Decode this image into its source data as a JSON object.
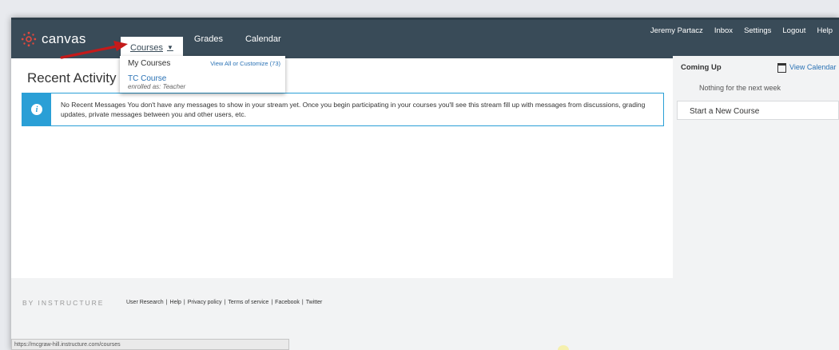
{
  "header": {
    "logo_text": "canvas",
    "nav": [
      {
        "label": "Courses",
        "caret": "▼"
      },
      {
        "label": "Grades"
      },
      {
        "label": "Calendar"
      }
    ],
    "user_menu": [
      "Jeremy Partacz",
      "Inbox",
      "Settings",
      "Logout",
      "Help"
    ]
  },
  "dropdown": {
    "my_courses": "My Courses",
    "view_all": "View All or Customize (73)",
    "course_name": "TC Course",
    "course_role": "enrolled as: Teacher"
  },
  "main": {
    "title": "Recent Activity",
    "alert_icon": "i",
    "alert_text": "No Recent Messages  You don't have any messages to show in your stream yet. Once you begin participating in your courses you'll see this stream fill up with messages from discussions, grading updates, private messages between you and other users, etc."
  },
  "sidebar": {
    "coming_up": "Coming Up",
    "view_calendar": "View Calendar",
    "nothing": "Nothing for the next week",
    "new_course": "Start a New Course"
  },
  "footer": {
    "brand": "BY INSTRUCTURE",
    "links": [
      "User Research",
      "Help",
      "Privacy policy",
      "Terms of service",
      "Facebook",
      "Twitter"
    ]
  },
  "statusbar": "https://mcgraw-hill.instructure.com/courses",
  "colors": {
    "header_bg": "#394b58",
    "link": "#2a72b5",
    "alert": "#2a9fd6",
    "logo": "#e2483d",
    "arrow": "#c41a1a"
  },
  "icons": [
    "canvas-logo-icon",
    "info-icon",
    "calendar-icon",
    "caret-down-icon",
    "annotation-arrow"
  ]
}
